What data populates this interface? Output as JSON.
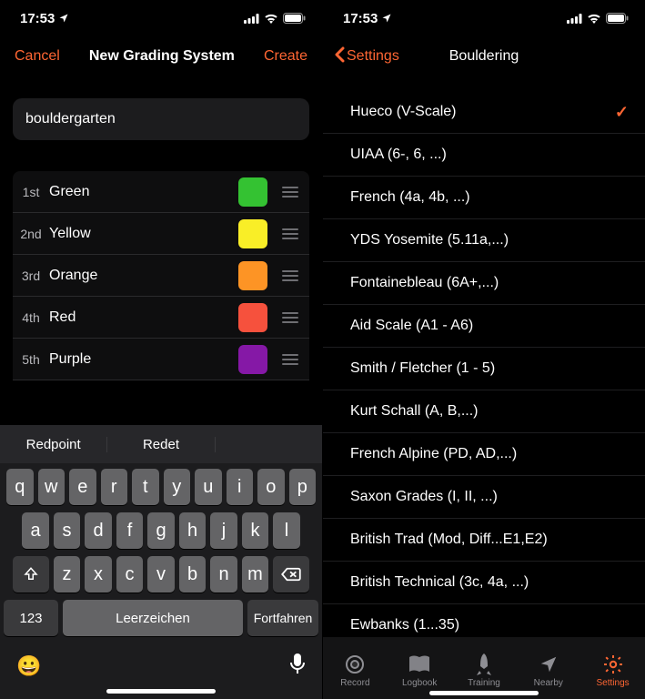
{
  "status": {
    "time": "17:53",
    "location_icon": "location-arrow"
  },
  "left": {
    "nav": {
      "cancel": "Cancel",
      "title": "New Grading System",
      "create": "Create"
    },
    "input_value": "bouldergarten",
    "grades": [
      {
        "ord": "1st",
        "name": "Green",
        "color": "#34c232"
      },
      {
        "ord": "2nd",
        "name": "Yellow",
        "color": "#f9ee27"
      },
      {
        "ord": "3rd",
        "name": "Orange",
        "color": "#fd9425"
      },
      {
        "ord": "4th",
        "name": "Red",
        "color": "#f6513d"
      },
      {
        "ord": "5th",
        "name": "Purple",
        "color": "#8518a6"
      }
    ],
    "keyboard": {
      "suggestions": [
        "Redpoint",
        "Redet",
        ""
      ],
      "row1": [
        "q",
        "w",
        "e",
        "r",
        "t",
        "y",
        "u",
        "i",
        "o",
        "p"
      ],
      "row2": [
        "a",
        "s",
        "d",
        "f",
        "g",
        "h",
        "j",
        "k",
        "l"
      ],
      "row3": [
        "z",
        "x",
        "c",
        "v",
        "b",
        "n",
        "m"
      ],
      "numbers": "123",
      "space": "Leerzeichen",
      "return": "Fortfahren"
    }
  },
  "right": {
    "back": "Settings",
    "title": "Bouldering",
    "items": [
      {
        "label": "Hueco (V-Scale)",
        "selected": true
      },
      {
        "label": "UIAA (6-, 6, ...)"
      },
      {
        "label": "French (4a, 4b, ...)"
      },
      {
        "label": "YDS Yosemite (5.11a,...)"
      },
      {
        "label": "Fontainebleau (6A+,...)"
      },
      {
        "label": "Aid Scale (A1 - A6)"
      },
      {
        "label": "Smith / Fletcher (1 - 5)"
      },
      {
        "label": "Kurt Schall (A, B,...)"
      },
      {
        "label": "French Alpine (PD, AD,...)"
      },
      {
        "label": "Saxon Grades (I, II, ...)"
      },
      {
        "label": "British Trad (Mod, Diff...E1,E2)"
      },
      {
        "label": "British Technical (3c, 4a, ...)"
      },
      {
        "label": "Ewbanks (1...35)"
      }
    ],
    "tabs": [
      {
        "label": "Record",
        "icon": "circle"
      },
      {
        "label": "Logbook",
        "icon": "book"
      },
      {
        "label": "Training",
        "icon": "rocket"
      },
      {
        "label": "Nearby",
        "icon": "arrow"
      },
      {
        "label": "Settings",
        "icon": "gear",
        "active": true
      }
    ]
  },
  "accent": "#ff6633"
}
